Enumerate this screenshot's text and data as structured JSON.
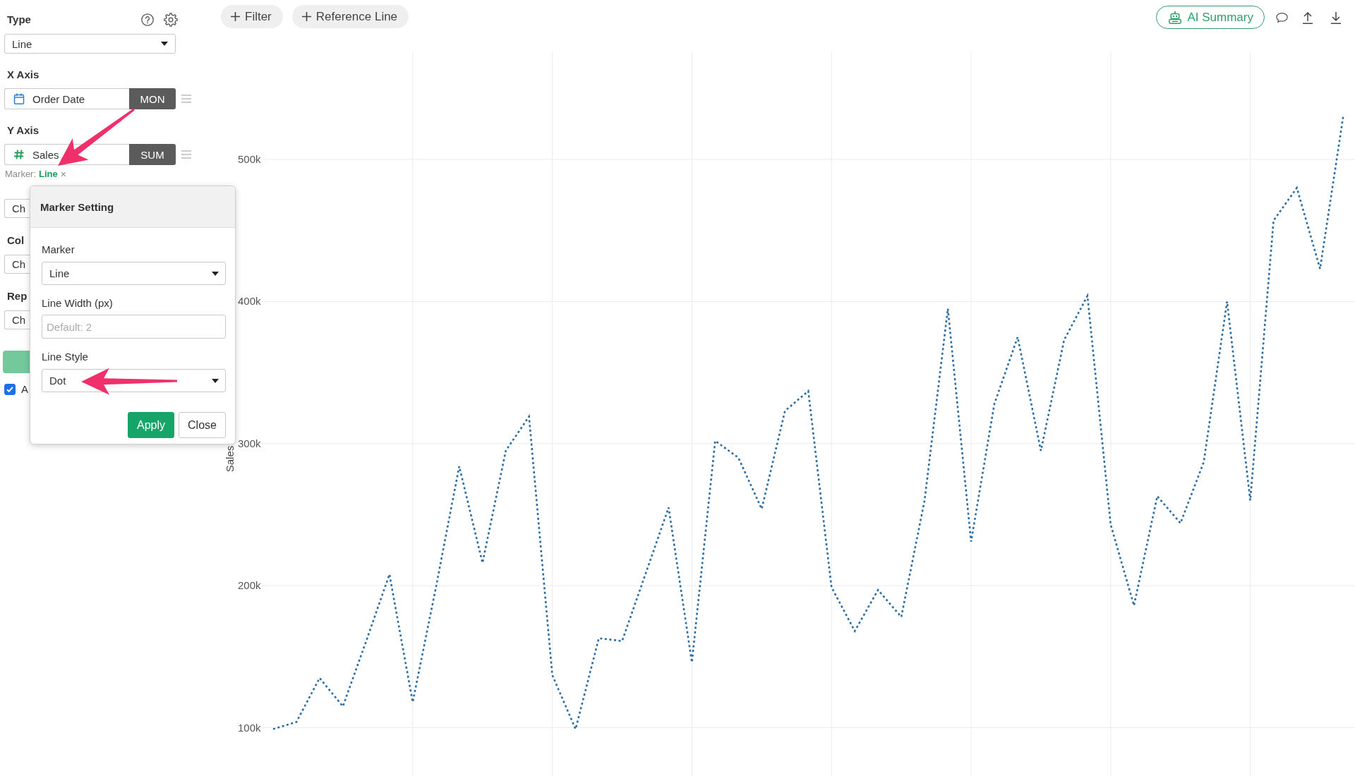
{
  "toolbar": {
    "buttons": [
      {
        "label": "Filter"
      },
      {
        "label": "Reference Line"
      }
    ],
    "ai_button": {
      "label": "AI Summary"
    }
  },
  "sidebar": {
    "type": {
      "label": "Type",
      "value": "Line"
    },
    "axes": [
      {
        "label": "X Axis",
        "kind": "date",
        "column": "Order Date",
        "aggregation": "MON"
      },
      {
        "label": "Y Axis",
        "kind": "number",
        "column": "Sales",
        "aggregation": "SUM",
        "marker": {
          "label": "Marker:",
          "value": "Line",
          "remove": "×"
        }
      }
    ],
    "more_controls": [
      {
        "kind": "select",
        "value": "Ch"
      },
      {
        "kind": "label",
        "text": "Col"
      },
      {
        "kind": "select",
        "value": "Ch"
      },
      {
        "kind": "label",
        "text": "Rep"
      },
      {
        "kind": "select",
        "value": "Ch"
      },
      {
        "kind": "button"
      },
      {
        "kind": "checkbox",
        "checked": true,
        "label": "A"
      }
    ]
  },
  "popup": {
    "title": "Marker Setting",
    "fields": [
      {
        "kind": "select",
        "label": "Marker",
        "value": "Line"
      },
      {
        "kind": "input",
        "label": "Line Width (px)",
        "placeholder": "Default: 2"
      },
      {
        "kind": "select",
        "label": "Line Style",
        "value": "Dot"
      }
    ],
    "buttons": [
      {
        "kind": "apply",
        "label": "Apply"
      },
      {
        "kind": "close",
        "label": "Close"
      }
    ]
  },
  "chart": {
    "chart_data": {
      "type": "line",
      "ylabel": "Sales",
      "ylim": [
        66000,
        576000
      ],
      "yticks": [
        {
          "value": 100000,
          "label": "100k"
        },
        {
          "value": 200000,
          "label": "200k"
        },
        {
          "value": 300000,
          "label": "300k"
        },
        {
          "value": 400000,
          "label": "400k"
        },
        {
          "value": 500000,
          "label": "500k"
        }
      ],
      "grid": true,
      "series": [
        {
          "color": "#2b6ca3",
          "line_style": "dotted",
          "values": [
            99000,
            104000,
            135000,
            115000,
            161000,
            208000,
            118000,
            199000,
            284000,
            216000,
            295000,
            319000,
            137000,
            99000,
            163000,
            161000,
            208000,
            255000,
            146000,
            302000,
            290000,
            254000,
            323000,
            337000,
            199000,
            168000,
            197000,
            178000,
            260000,
            395000,
            231000,
            328000,
            375000,
            295000,
            373000,
            404000,
            243000,
            186000,
            263000,
            244000,
            287000,
            400000,
            260000,
            457000,
            480000,
            423000,
            531000
          ]
        }
      ]
    }
  }
}
